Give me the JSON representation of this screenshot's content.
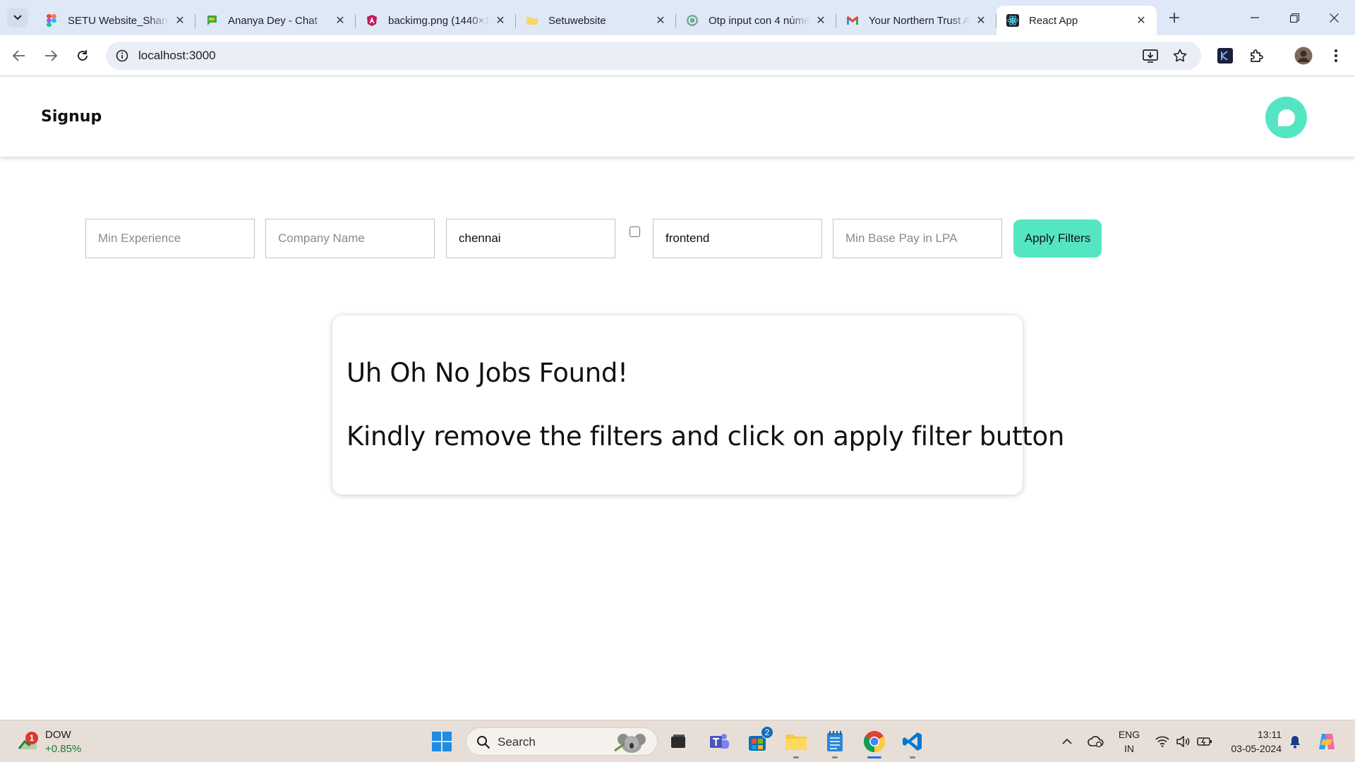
{
  "browser": {
    "tabs": [
      {
        "title": "SETU Website_Shared",
        "icon": "figma-icon"
      },
      {
        "title": "Ananya Dey - Chat",
        "icon": "google-chat-icon"
      },
      {
        "title": "backimg.png (1440×1024)",
        "icon": "angular-icon"
      },
      {
        "title": "Setuwebsite",
        "icon": "folder-icon"
      },
      {
        "title": "Otp input con 4 números",
        "icon": "openai-icon"
      },
      {
        "title": "Your Northern Trust Application",
        "icon": "gmail-icon"
      },
      {
        "title": "React App",
        "icon": "react-icon"
      }
    ],
    "active_tab_index": 6,
    "url": "localhost:3000"
  },
  "app": {
    "header_title": "Signup",
    "accent_color": "#54e6c2",
    "filters": {
      "min_experience": {
        "placeholder": "Min Experience",
        "value": ""
      },
      "company_name": {
        "placeholder": "Company Name",
        "value": ""
      },
      "location": {
        "placeholder": "",
        "value": "chennai"
      },
      "remote_checked": false,
      "role": {
        "placeholder": "",
        "value": "frontend"
      },
      "min_base_pay": {
        "placeholder": "Min Base Pay in LPA",
        "value": ""
      },
      "apply_label": "Apply Filters"
    },
    "empty_state": {
      "title": "Uh Oh No Jobs Found!",
      "message": "Kindly remove the filters and click on apply filter button"
    }
  },
  "taskbar": {
    "widget": {
      "name": "DOW",
      "change": "+0.85%",
      "badge": "1"
    },
    "search_label": "Search",
    "store_badge": "2",
    "language": {
      "line1": "ENG",
      "line2": "IN"
    },
    "time": "13:11",
    "date": "03-05-2024"
  }
}
